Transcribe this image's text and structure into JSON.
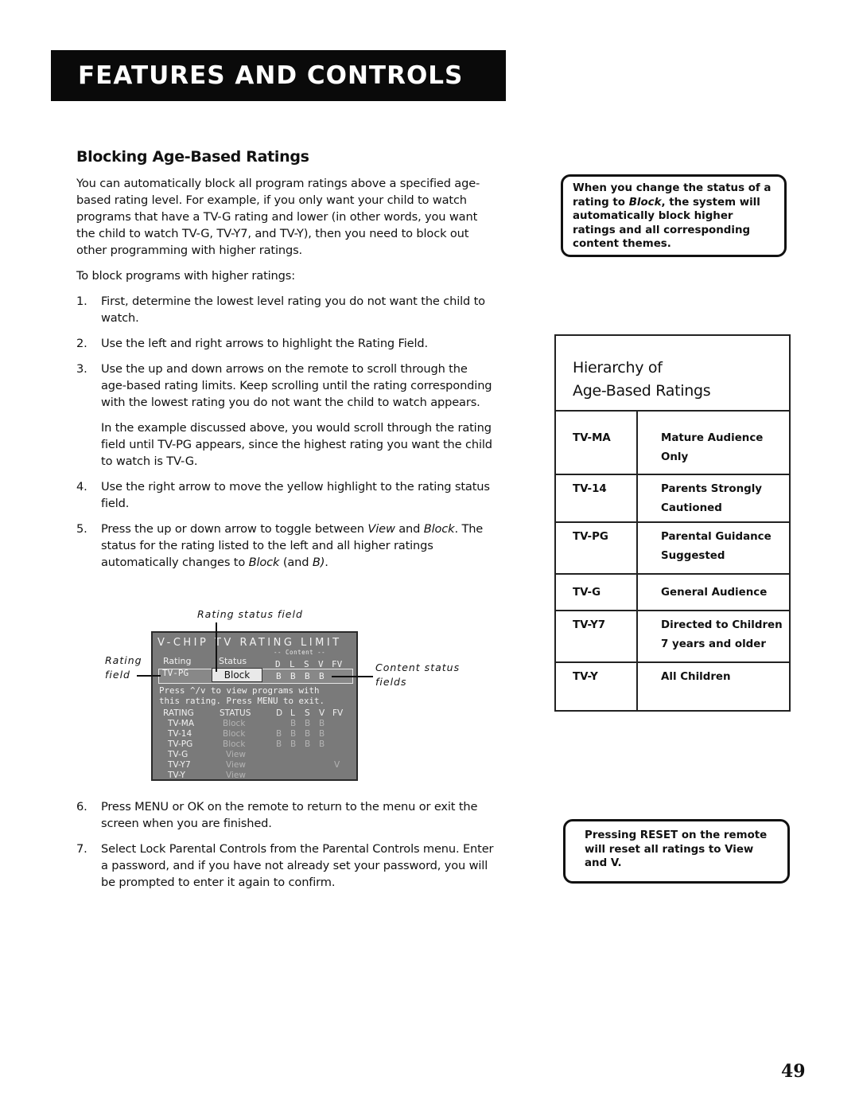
{
  "header": {
    "banner_title": "FEATURES AND CONTROLS"
  },
  "section": {
    "title": "Blocking Age-Based Ratings",
    "intro": "You can automatically block all program ratings above a specified age-based rating level. For example, if you only want your child to watch programs that have a TV-G rating and lower (in other words, you want the child to watch TV-G, TV-Y7, and TV-Y), then you need to block out other programming with higher ratings.",
    "lead": "To block programs with higher ratings:",
    "steps": [
      {
        "num": "1.",
        "text": "First, determine the lowest level rating you do not want the child to watch."
      },
      {
        "num": "2.",
        "text": "Use the left and right arrows to highlight the Rating Field."
      },
      {
        "num": "3.",
        "text": "Use the up and down arrows on the remote to scroll through the age-based rating limits. Keep scrolling until the rating corresponding with the lowest rating you do not want the child to watch appears.",
        "extra": "In the example discussed above, you would scroll through the rating field until TV-PG appears, since the highest rating you want the child to watch is TV-G."
      },
      {
        "num": "4.",
        "text": "Use the right arrow to move the yellow highlight to the rating status field."
      },
      {
        "num": "5.",
        "text_parts": [
          "Press the up or down arrow to toggle between ",
          "View",
          " and ",
          "Block",
          ". The status for the rating listed to the left and all higher ratings automatically changes to ",
          "Block",
          " (and ",
          "B)",
          "."
        ]
      },
      {
        "num": "6.",
        "text": "Press MENU or OK on the remote to return to the menu or exit the screen when you are finished."
      },
      {
        "num": "7.",
        "text": "Select Lock Parental Controls from the Parental Controls menu. Enter a password, and if you have not already set your password, you will be prompted to enter it again to confirm."
      }
    ]
  },
  "diagram": {
    "callouts": {
      "rating_status_field": "Rating status field",
      "rating_field_1": "Rating",
      "rating_field_2": "field",
      "content_status_1": "Content status",
      "content_status_2": "fields"
    },
    "screen": {
      "title": "V-CHIP TV RATING LIMIT",
      "content_label": "-- Content --",
      "col_rating": "Rating",
      "col_status": "Status",
      "content_cols": [
        "D",
        "L",
        "S",
        "V",
        "FV"
      ],
      "selected": {
        "rating": "TV-PG",
        "status": "Block",
        "content": [
          "B",
          "B",
          "B",
          "B",
          ""
        ]
      },
      "hint": "Press ^/v to view programs with\nthis rating. Press MENU to exit.",
      "table_headers": {
        "rating": "RATING",
        "status": "STATUS"
      },
      "rows": [
        {
          "rating": "TV-MA",
          "status": "Block",
          "content": [
            "",
            "B",
            "B",
            "B",
            ""
          ]
        },
        {
          "rating": "TV-14",
          "status": "Block",
          "content": [
            "B",
            "B",
            "B",
            "B",
            ""
          ]
        },
        {
          "rating": "TV-PG",
          "status": "Block",
          "content": [
            "B",
            "B",
            "B",
            "B",
            ""
          ]
        },
        {
          "rating": "TV-G",
          "status": "View",
          "content": [
            "",
            "",
            "",
            "",
            ""
          ]
        },
        {
          "rating": "TV-Y7",
          "status": "View",
          "content": [
            "",
            "",
            "",
            "",
            "V"
          ]
        },
        {
          "rating": "TV-Y",
          "status": "View",
          "content": [
            "",
            "",
            "",
            "",
            ""
          ]
        }
      ]
    }
  },
  "notes": {
    "block_note_parts": [
      "When you change the status of a rating to ",
      "Block",
      ", the system will automatically block higher ratings and all corresponding content themes."
    ],
    "reset_note": "Pressing RESET on the remote will reset all ratings to View and V."
  },
  "hierarchy": {
    "title_line1": "Hierarchy of",
    "title_line2": "Age-Based Ratings",
    "rows": [
      {
        "code": "TV-MA",
        "desc1": "Mature Audience",
        "desc2": "Only"
      },
      {
        "code": "TV-14",
        "desc1": "Parents Strongly",
        "desc2": "Cautioned"
      },
      {
        "code": "TV-PG",
        "desc1": "Parental Guidance",
        "desc2": "Suggested"
      },
      {
        "code": "TV-G",
        "desc1": "General Audience",
        "desc2": ""
      },
      {
        "code": "TV-Y7",
        "desc1": "Directed to Children",
        "desc2": "7 years and older"
      },
      {
        "code": "TV-Y",
        "desc1": "All Children",
        "desc2": ""
      }
    ]
  },
  "page_number": "49"
}
